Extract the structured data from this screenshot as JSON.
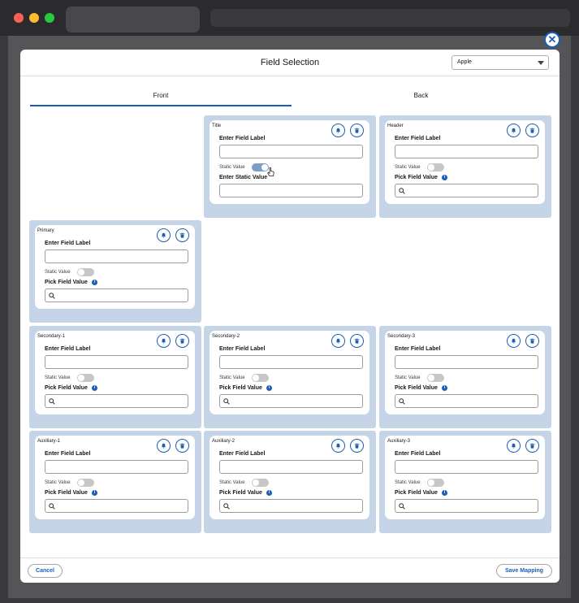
{
  "modal": {
    "title": "Field Selection",
    "template_select": {
      "value": "Apple"
    },
    "tabs": [
      {
        "label": "Front",
        "active": true
      },
      {
        "label": "Back",
        "active": false
      }
    ],
    "close_label": "✕"
  },
  "card_text": {
    "enter_field_label": "Enter Field Label",
    "static_value": "Static Value",
    "pick_field_value": "Pick Field Value",
    "enter_static_value": "Enter Static Value",
    "info": "i"
  },
  "cards": [
    {
      "slot": "Title",
      "static_on": true
    },
    {
      "slot": "Header",
      "static_on": false
    },
    {
      "slot": "Primary",
      "static_on": false
    },
    {
      "slot": "Secondary-1",
      "static_on": false
    },
    {
      "slot": "Secondary-2",
      "static_on": false
    },
    {
      "slot": "Secondary-3",
      "static_on": false
    },
    {
      "slot": "Auxiliary-1",
      "static_on": false
    },
    {
      "slot": "Auxiliary-2",
      "static_on": false
    },
    {
      "slot": "Auxiliary-3",
      "static_on": false
    }
  ],
  "footer": {
    "cancel_label": "Cancel",
    "save_label": "Save Mapping"
  },
  "colors": {
    "accent": "#1b5fb4",
    "slot_bg": "#c5d4e6"
  }
}
